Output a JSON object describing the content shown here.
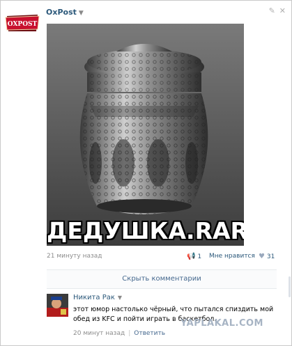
{
  "post": {
    "author": "OxPost",
    "avatar_text": "OXPOST",
    "image_caption": "ДЕДУШКА.RAR",
    "time": "21 минуту назад",
    "reposts": "1",
    "like_label": "Мне нравится",
    "likes": "31"
  },
  "comments_toggle": "Скрыть комментарии",
  "comment": {
    "author": "Никита Рак",
    "text": "этот юмор настолько чёрный, что пытался спиздить мой обед из KFC и пойти играть в баскетбол.",
    "time": "20 минут назад",
    "reply": "Ответить"
  },
  "watermark": "YAPLAKAL.COM",
  "icons": [
    "dropdown-caret-icon",
    "edit-icon",
    "close-icon",
    "repost-icon",
    "heart-icon"
  ],
  "colors": {
    "link": "#2b587a",
    "meta": "#8c8c8c",
    "accent": "#45688e",
    "logo_red": "#c8102e"
  }
}
